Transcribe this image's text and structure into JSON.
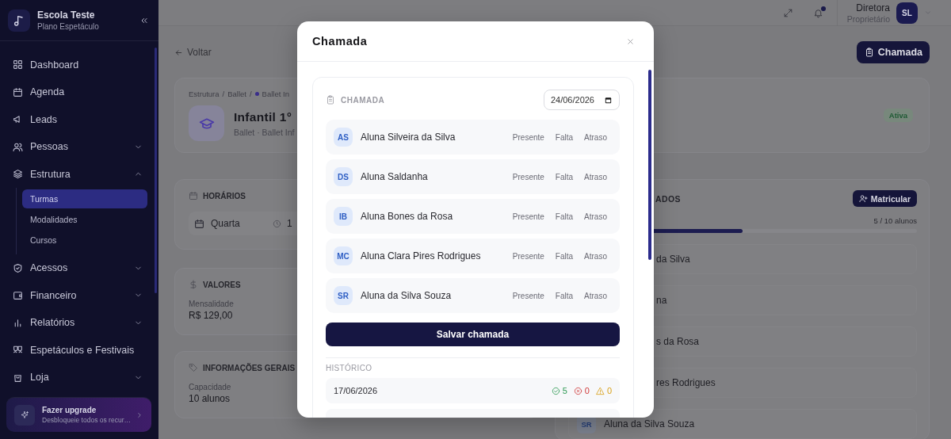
{
  "sidebar": {
    "brand": {
      "name": "Escola Teste",
      "plan": "Plano Espetáculo"
    },
    "items": [
      {
        "label": "Dashboard"
      },
      {
        "label": "Agenda"
      },
      {
        "label": "Leads"
      },
      {
        "label": "Pessoas",
        "expanded": false
      },
      {
        "label": "Estrutura",
        "expanded": true,
        "children": [
          {
            "label": "Turmas",
            "selected": true
          },
          {
            "label": "Modalidades",
            "selected": false
          },
          {
            "label": "Cursos",
            "selected": false
          }
        ]
      },
      {
        "label": "Acessos",
        "expanded": false
      },
      {
        "label": "Financeiro",
        "expanded": false
      },
      {
        "label": "Relatórios",
        "expanded": false
      },
      {
        "label": "Espetáculos e Festivais"
      },
      {
        "label": "Loja",
        "expanded": false
      }
    ],
    "upgrade": {
      "title": "Fazer upgrade",
      "subtitle": "Desbloqueie todos os recur…"
    }
  },
  "topbar": {
    "notifications_unread": true,
    "user_name": "Diretora",
    "user_role": "Proprietário",
    "avatar": "SL"
  },
  "page": {
    "back": "Voltar",
    "action": "Chamada"
  },
  "header_card": {
    "breadcrumb": {
      "items": [
        "Estrutura",
        "Ballet",
        "Ballet In"
      ],
      "separator": "/"
    },
    "title": "Infantil 1°",
    "subtitle": "Ballet · Ballet Inf",
    "status": "Ativa"
  },
  "schedule": {
    "title": "HORÁRIOS",
    "day": "Quarta",
    "time": "1"
  },
  "prices": {
    "title": "VALORES",
    "label": "Mensalidade",
    "value": "R$ 129,00"
  },
  "info": {
    "title": "INFORMAÇÕES GERAIS",
    "label": "Capacidade",
    "value": "10 alunos"
  },
  "enrolled": {
    "title": "ADOS",
    "button": "Matricular",
    "count": "5 / 10 alunos",
    "level": 0.5,
    "students": [
      {
        "kind": "covered",
        "name": "da Silva"
      },
      {
        "kind": "covered",
        "name": "na"
      },
      {
        "kind": "covered",
        "name": "s da Rosa"
      },
      {
        "kind": "covered",
        "name": "res Rodrigues"
      },
      {
        "kind": "full",
        "initials": "SR",
        "name": "Aluna da Silva Souza"
      }
    ]
  },
  "modal": {
    "title": "Chamada",
    "section": "CHAMADA",
    "date": "24/06/2026",
    "students": [
      {
        "initials": "AS",
        "name": "Aluna Silveira da Silva",
        "options": [
          {
            "label": "Presente",
            "selected": false
          },
          {
            "label": "Falta",
            "selected": false
          },
          {
            "label": "Atraso",
            "selected": false
          }
        ]
      },
      {
        "initials": "DS",
        "name": "Aluna Saldanha",
        "options": [
          {
            "label": "Presente",
            "selected": false
          },
          {
            "label": "Falta",
            "selected": false
          },
          {
            "label": "Atraso",
            "selected": false
          }
        ]
      },
      {
        "initials": "IB",
        "name": "Aluna Bones da Rosa",
        "options": [
          {
            "label": "Presente",
            "selected": false
          },
          {
            "label": "Falta",
            "selected": false
          },
          {
            "label": "Atraso",
            "selected": false
          }
        ]
      },
      {
        "initials": "MC",
        "name": "Aluna Clara Pires Rodrigues",
        "options": [
          {
            "label": "Presente",
            "selected": false
          },
          {
            "label": "Falta",
            "selected": false
          },
          {
            "label": "Atraso",
            "selected": false
          }
        ]
      },
      {
        "initials": "SR",
        "name": "Aluna da Silva Souza",
        "options": [
          {
            "label": "Presente",
            "selected": false
          },
          {
            "label": "Falta",
            "selected": false
          },
          {
            "label": "Atraso",
            "selected": false
          }
        ]
      }
    ],
    "save": "Salvar chamada",
    "history_title": "HISTÓRICO",
    "history": [
      {
        "date": "17/06/2026",
        "present": "5",
        "absent": "0",
        "late": "0"
      }
    ]
  }
}
